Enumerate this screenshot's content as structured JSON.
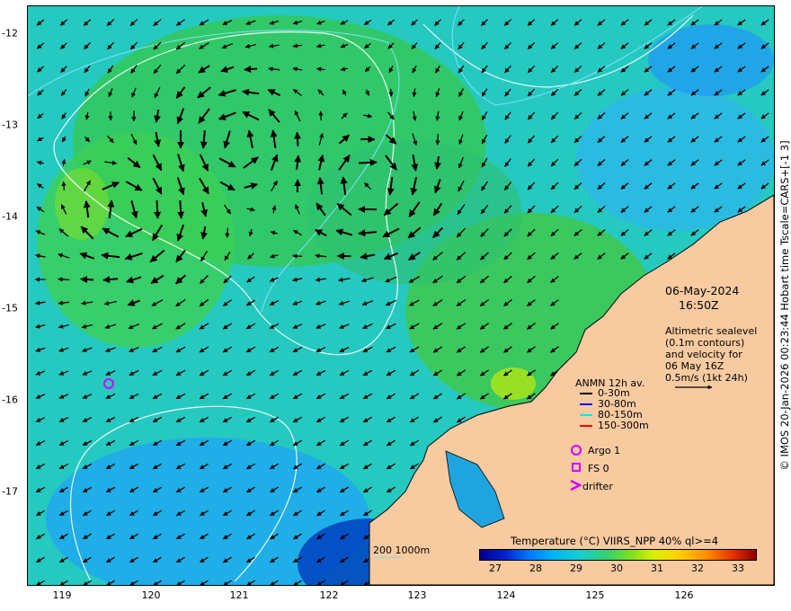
{
  "map": {
    "x_ticks": [
      "119",
      "120",
      "121",
      "122",
      "123",
      "124",
      "125",
      "126"
    ],
    "y_ticks": [
      "-12",
      "-13",
      "-14",
      "-15",
      "-16",
      "-17"
    ],
    "x_range": [
      118.6,
      127.0
    ],
    "y_range": [
      -11.7,
      -18.0
    ]
  },
  "title": {
    "date": "06-May-2024",
    "time": "16:50Z"
  },
  "altimetry_caption": [
    "Altimetric sealevel",
    "(0.1m contours)",
    "and velocity for",
    "06 May 16Z",
    "0.5m/s (1kt 24h)"
  ],
  "anmn": {
    "title": "ANMN 12h av.",
    "items": [
      {
        "label": "0-30m",
        "color": "#000000"
      },
      {
        "label": "30-80m",
        "color": "#0000ff"
      },
      {
        "label": "80-150m",
        "color": "#00e5ff"
      },
      {
        "label": "150-300m",
        "color": "#ff0000"
      }
    ]
  },
  "legend_markers": {
    "argo": "Argo 1",
    "fs": "FS 0",
    "drifter": "drifter",
    "marker_color": "#d400ff"
  },
  "colorbar": {
    "title": "Temperature (°C) VIIRS_NPP 40% ql>=4",
    "ticks": [
      "27",
      "28",
      "29",
      "30",
      "31",
      "32",
      "33"
    ],
    "range": [
      26.4,
      33.6
    ]
  },
  "depth_contour_label": "200  1000m",
  "side_caption": "© IMOS 20-Jan-2026 00:23:44 Hobart time Tscale=CARS+[-1 3]",
  "colors": {
    "land": "#f8caa0",
    "ocean_base": "#25c9c0",
    "arrow": "#000000",
    "contour": "#ffffff"
  }
}
